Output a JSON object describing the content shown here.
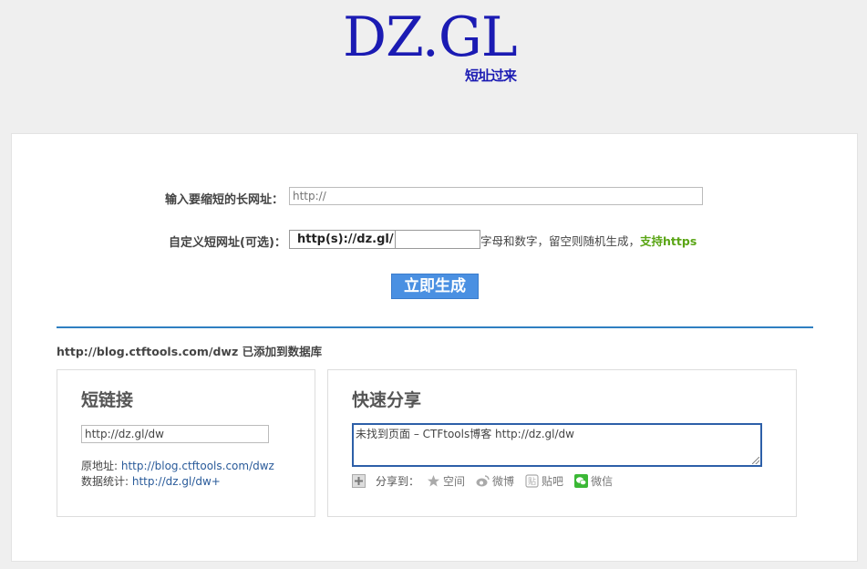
{
  "logo": {
    "title": "DZ.GL",
    "subtitle": "短址过来"
  },
  "form": {
    "long_url_label": "输入要缩短的长网址：",
    "long_url_placeholder": "http://",
    "custom_label": "自定义短网址(可选)：",
    "custom_prefix": "http(s)://dz.gl/",
    "custom_hint": "字母和数字，留空则随机生成，",
    "custom_hint_https": "支持https",
    "generate_button": "立即生成"
  },
  "status_message": "http://blog.ctftools.com/dwz 已添加到数据库",
  "short_link_panel": {
    "title": "短链接",
    "short_url": "http://dz.gl/dw",
    "origin_label": "原地址: ",
    "origin_url": "http://blog.ctftools.com/dwz",
    "stats_label": "数据统计: ",
    "stats_url": "http://dz.gl/dw+"
  },
  "share_panel": {
    "title": "快速分享",
    "share_text": "未找到页面 – CTFtools博客 http://dz.gl/dw",
    "share_to_label": "分享到：",
    "targets": [
      {
        "label": "空间",
        "icon": "qzone-star-icon"
      },
      {
        "label": "微博",
        "icon": "weibo-icon"
      },
      {
        "label": "贴吧",
        "icon": "tieba-icon"
      },
      {
        "label": "微信",
        "icon": "wechat-icon"
      }
    ]
  },
  "colors": {
    "brand": "#1b1bb3",
    "accent": "#4a90e2",
    "divider": "#2f7fc1",
    "https": "#5aa515"
  }
}
